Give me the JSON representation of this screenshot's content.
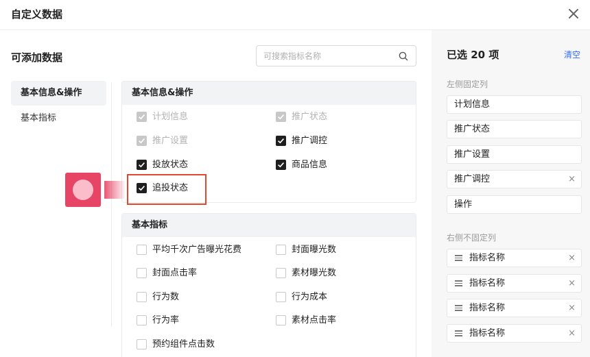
{
  "dialog": {
    "title": "自定义数据"
  },
  "left": {
    "title": "可添加数据",
    "search_placeholder": "可搜索指标名称",
    "categories": [
      {
        "label": "基本信息&操作",
        "active": true
      },
      {
        "label": "基本指标",
        "active": false
      }
    ],
    "groups": [
      {
        "header": "基本信息&操作",
        "options": [
          {
            "label": "计划信息",
            "state": "checked-disabled"
          },
          {
            "label": "推广状态",
            "state": "checked-disabled"
          },
          {
            "label": "推广设置",
            "state": "checked-disabled"
          },
          {
            "label": "推广调控",
            "state": "checked"
          },
          {
            "label": "投放状态",
            "state": "checked"
          },
          {
            "label": "商品信息",
            "state": "checked"
          },
          {
            "label": "追投状态",
            "state": "checked"
          }
        ]
      },
      {
        "header": "基本指标",
        "options": [
          {
            "label": "平均千次广告曝光花费",
            "state": "unchecked"
          },
          {
            "label": "封面曝光数",
            "state": "unchecked"
          },
          {
            "label": "封面点击率",
            "state": "unchecked"
          },
          {
            "label": "素材曝光数",
            "state": "unchecked"
          },
          {
            "label": "行为数",
            "state": "unchecked"
          },
          {
            "label": "行为成本",
            "state": "unchecked"
          },
          {
            "label": "行为率",
            "state": "unchecked"
          },
          {
            "label": "素材点击率",
            "state": "unchecked"
          },
          {
            "label": "预约组件点击数",
            "state": "unchecked"
          }
        ]
      }
    ]
  },
  "right": {
    "selected_title": "已选 20 项",
    "clear_label": "清空",
    "fixed_label": "左侧固定列",
    "fixed_items": [
      {
        "label": "计划信息",
        "removable": false
      },
      {
        "label": "推广状态",
        "removable": false
      },
      {
        "label": "推广设置",
        "removable": false
      },
      {
        "label": "推广调控",
        "removable": true
      },
      {
        "label": "操作",
        "removable": false
      }
    ],
    "unfixed_label": "右侧不固定列",
    "unfixed_items": [
      {
        "label": "指标名称"
      },
      {
        "label": "指标名称"
      },
      {
        "label": "指标名称"
      },
      {
        "label": "指标名称"
      }
    ],
    "remove_glyph": "×"
  },
  "colors": {
    "highlight": "#e4462e",
    "accent": "#2f6bff",
    "checked": "#1f1f1f",
    "disabled": "#c8c8c8"
  }
}
